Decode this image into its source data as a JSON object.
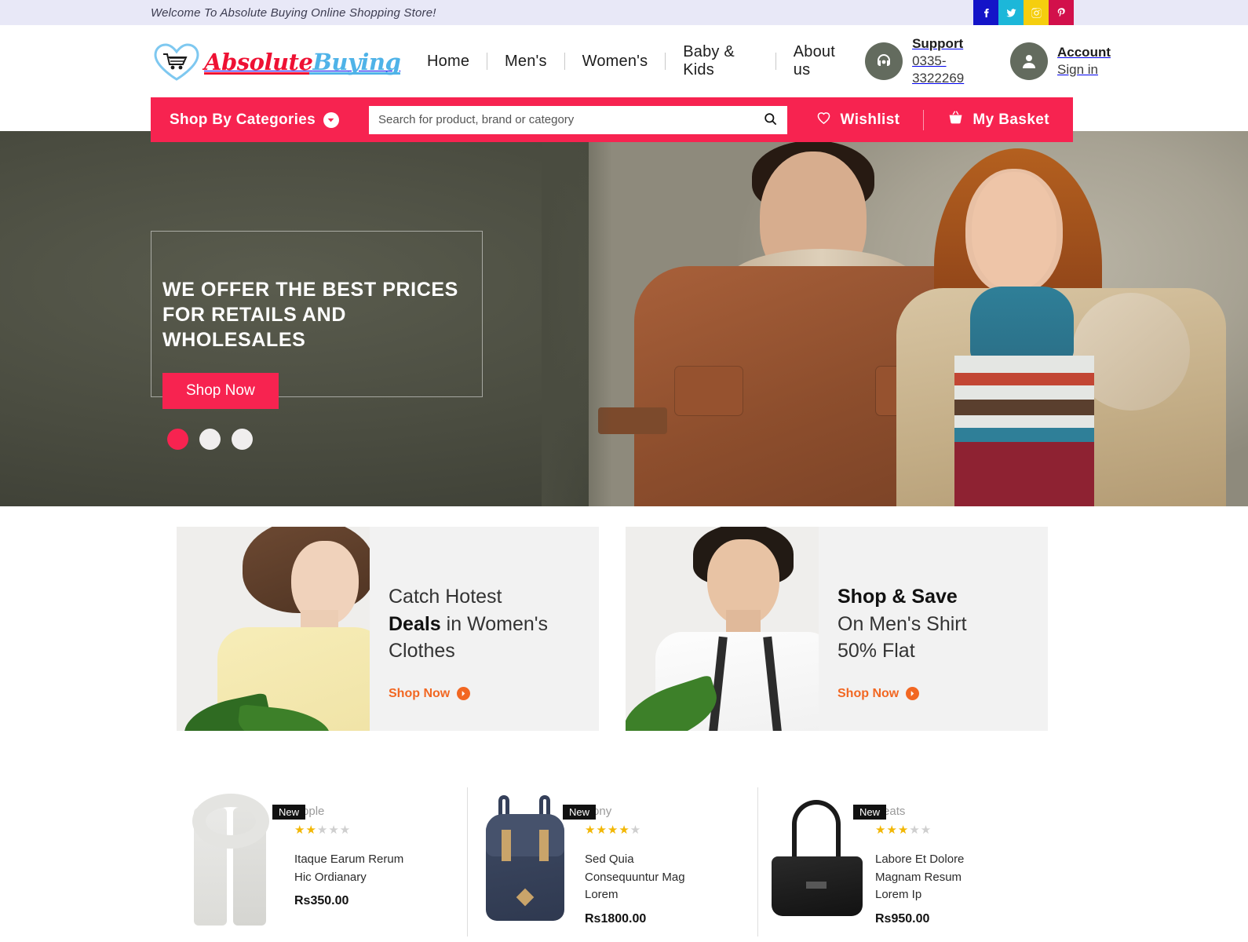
{
  "topbar": {
    "welcome": "Welcome To Absolute Buying Online Shopping Store!",
    "social": [
      {
        "name": "facebook",
        "label": "Facebook"
      },
      {
        "name": "twitter",
        "label": "Twitter"
      },
      {
        "name": "instagram",
        "label": "Instagram"
      },
      {
        "name": "pinterest",
        "label": "Pinterest"
      }
    ]
  },
  "logo": {
    "part1": "Absolute",
    "part2": "Buying"
  },
  "nav": {
    "items": [
      "Home",
      "Men's",
      "Women's",
      "Baby & Kids",
      "About us"
    ]
  },
  "support": {
    "title": "Support",
    "phone": "0335-3322269"
  },
  "account": {
    "title": "Account",
    "action": "Sign in"
  },
  "redbar": {
    "categories": "Shop By Categories",
    "search_placeholder": "Search for product, brand or category",
    "search_value": "",
    "wishlist": "Wishlist",
    "basket": "My Basket",
    "accent": "#f72350"
  },
  "hero": {
    "title": "WE OFFER THE BEST PRICES FOR RETAILS AND WHOLESALES",
    "button": "Shop Now",
    "slides": 3,
    "active_slide": 1
  },
  "promos": [
    {
      "line1": "Catch Hotest",
      "bold": "Deals",
      "line2_rest": " in Women's",
      "line3": "Clothes",
      "cta": "Shop Now",
      "bold_first": false
    },
    {
      "line1": "Shop & Save",
      "bold": "Shop & Save",
      "line2_rest": "On Men's Shirt",
      "line3": "50% Flat",
      "cta": "Shop Now",
      "bold_first": true
    }
  ],
  "products": [
    {
      "badge": "New",
      "brand": "Apple",
      "rating": 2,
      "name": "Itaque Earum Rerum Hic Ordianary",
      "price": "Rs350.00"
    },
    {
      "badge": "New",
      "brand": "Sony",
      "rating": 4,
      "name": "Sed Quia Consequuntur Mag Lorem",
      "price": "Rs1800.00"
    },
    {
      "badge": "New",
      "brand": "Beats",
      "rating": 3,
      "name": "Labore Et Dolore Magnam Resum Lorem Ip",
      "price": "Rs950.00"
    }
  ]
}
